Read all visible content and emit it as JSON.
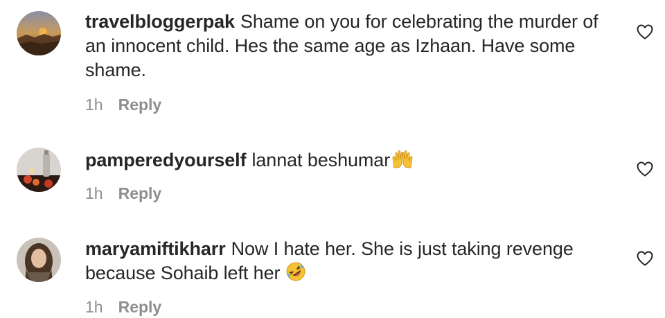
{
  "comments": [
    {
      "username": "travelbloggerpak",
      "text": "Shame on you for celebrating the murder of an innocent child. Hes the same age as Izhaan. Have some shame.",
      "time": "1h",
      "reply_label": "Reply",
      "emoji": ""
    },
    {
      "username": "pamperedyourself",
      "text": "lannat beshumar",
      "time": "1h",
      "reply_label": "Reply",
      "emoji": "raising-hands"
    },
    {
      "username": "maryamiftikharr",
      "text": "Now I hate her. She is just taking revenge because Sohaib left her",
      "time": "1h",
      "reply_label": "Reply",
      "emoji": "rolling-on-floor-laughing"
    }
  ],
  "colors": {
    "text": "#262626",
    "meta": "#8e8e8e",
    "background": "#ffffff"
  },
  "icons": {
    "like": "heart-outline-icon"
  }
}
